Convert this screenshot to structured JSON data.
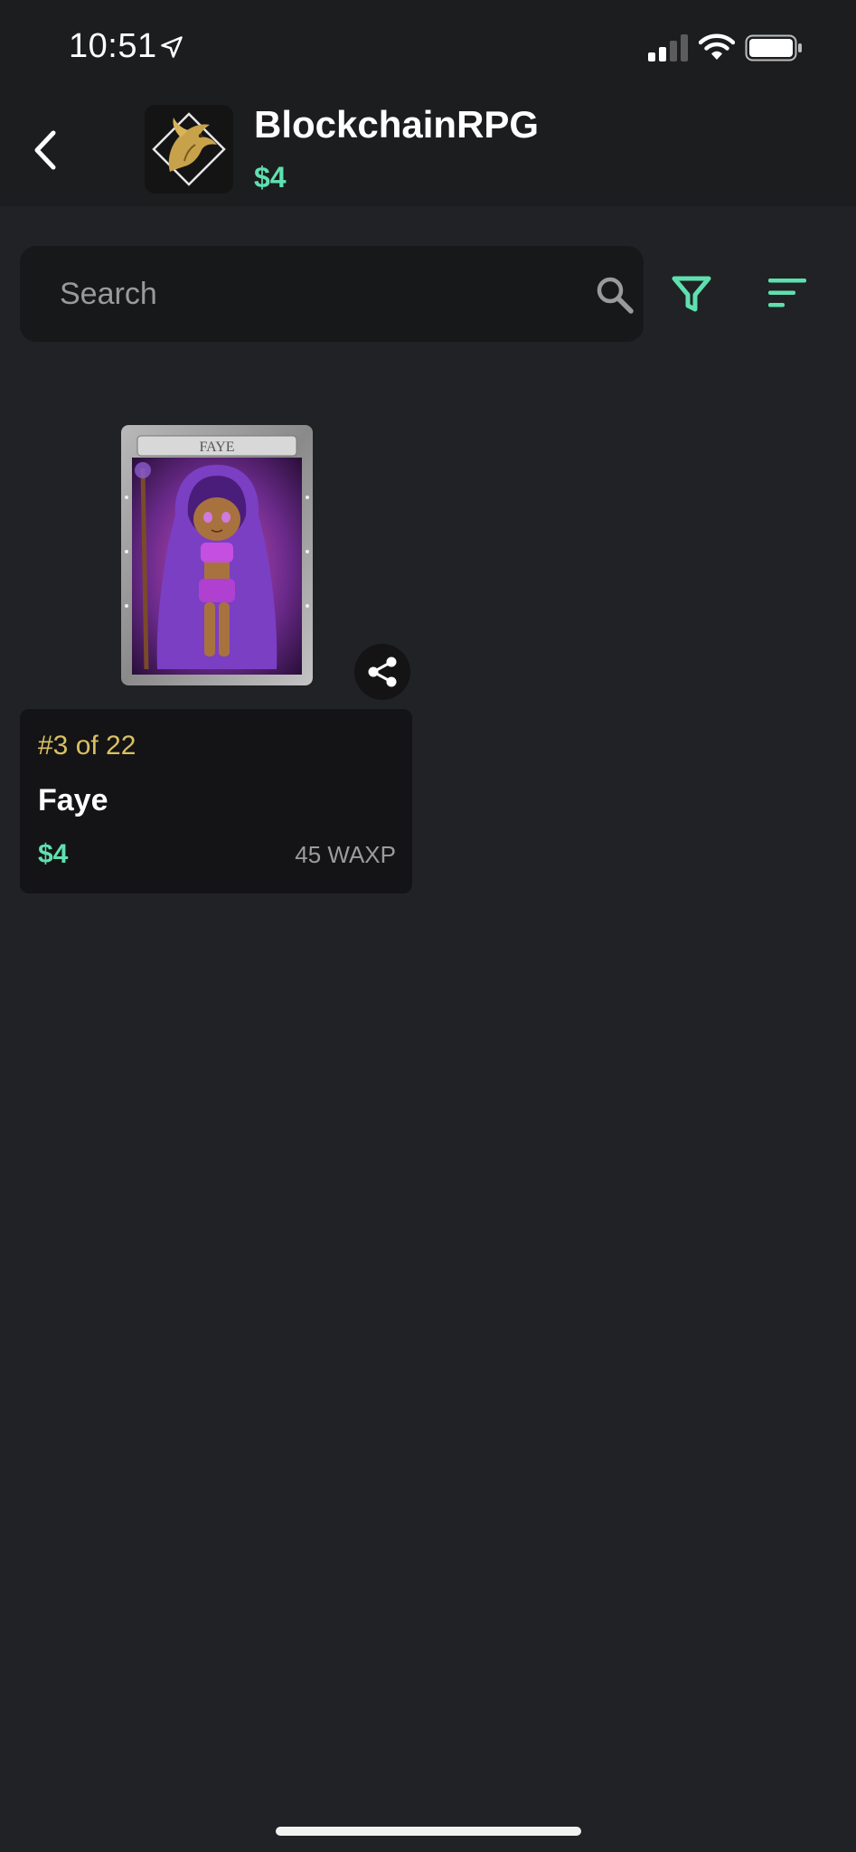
{
  "status_bar": {
    "time": "10:51"
  },
  "header": {
    "collection_name": "BlockchainRPG",
    "collection_price": "$4"
  },
  "search": {
    "placeholder": "Search"
  },
  "cards": [
    {
      "image_title": "FAYE",
      "mint": "#3 of 22",
      "name": "Faye",
      "price_usd": "$4",
      "price_wax": "45 WAXP"
    }
  ],
  "colors": {
    "background": "#212225",
    "header_bg": "#1c1d1f",
    "accent_green": "#5fe0b0",
    "mint_gold": "#d9c160",
    "card_bg": "#141416"
  },
  "icons": {
    "back": "chevron-left-icon",
    "location": "location-arrow-icon",
    "signal": "cellular-signal-icon",
    "wifi": "wifi-icon",
    "battery": "battery-icon",
    "search": "search-icon",
    "filter": "filter-icon",
    "sort": "sort-icon",
    "share": "share-icon"
  }
}
